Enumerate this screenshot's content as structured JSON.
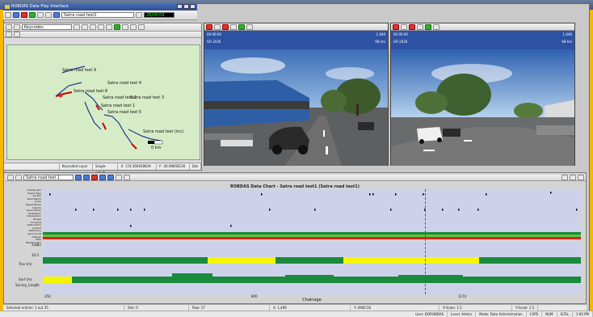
{
  "window": {
    "title": "ROBDAS Data Play Interface"
  },
  "playbar": {
    "survey": "Satra road test1",
    "value": "28/06/09"
  },
  "map": {
    "layer_dropdown": "Keycodes",
    "status": {
      "layer": "Keycoded Layer",
      "mode": "Single-select",
      "x": "X: 174.566458839",
      "y": "Y: -36.90858126",
      "extra": "Dat"
    },
    "labels": [
      "Satra road test 9",
      "Satra road test 8",
      "Satra road test 4",
      "Satra road test 2",
      "Satra road test 3",
      "Satra road test 1",
      "Satra road test 5",
      "Satra road test (inc)"
    ],
    "scale": "0 km"
  },
  "videos": [
    {
      "name": "left-camera",
      "header_left": [
        "00:00:00",
        "GR 2026"
      ],
      "header_right": [
        "1,040",
        "68 km"
      ]
    },
    {
      "name": "right-camera",
      "header_left": [
        "00:00:00",
        "GR 2026"
      ],
      "header_right": [
        "1,040",
        "68 km"
      ]
    }
  ],
  "chart": {
    "toolbar_dropdown": "Satra road test 1",
    "title": "ROBDAS Data Chart - Satra road test1 (Satra road test1)",
    "track_labels": [
      "Overlay Bar",
      "Event Type",
      "Survey",
      "Road Name",
      "Jump",
      "Speed Bump",
      "Vehicle",
      "Road Works",
      "Pedestrian",
      "Intersection",
      "Bridge",
      "Crossing",
      "Obstruction",
      "Culvert",
      "Reference",
      "Lane Count",
      "Change",
      "Stop",
      "Bladed Lane",
      "Start"
    ],
    "mid_labels": [
      "12.0",
      "10.0",
      "Trav (m)",
      "Surf (m)"
    ],
    "bottom_label": "Survey_Length",
    "x_ticks": [
      "350",
      "800",
      "1174"
    ],
    "xlabel": "Chainage",
    "colors": {
      "track_bg": "#cdd2ea",
      "green": "#1a8a3c",
      "yellow": "#f5f500",
      "red": "#e02020",
      "cursor": "#3355cc"
    }
  },
  "status_bar": {
    "selected": "Selected entries: 1 out 35",
    "site": "Site: 0",
    "row": "Row: 17",
    "x": "X: 1,496",
    "y": "Y: 4900.56",
    "xscale": "X-Scale: 1.5",
    "yscale": "Y-Scale: 1.5"
  },
  "system_bar": {
    "user": "User: DOROBDAS",
    "level": "Level: Admin",
    "mode": "Mode: Data Administration",
    "caps": "CAPS",
    "num": "NUM",
    "scrl": "SCRL",
    "time": "1:00 PM"
  }
}
